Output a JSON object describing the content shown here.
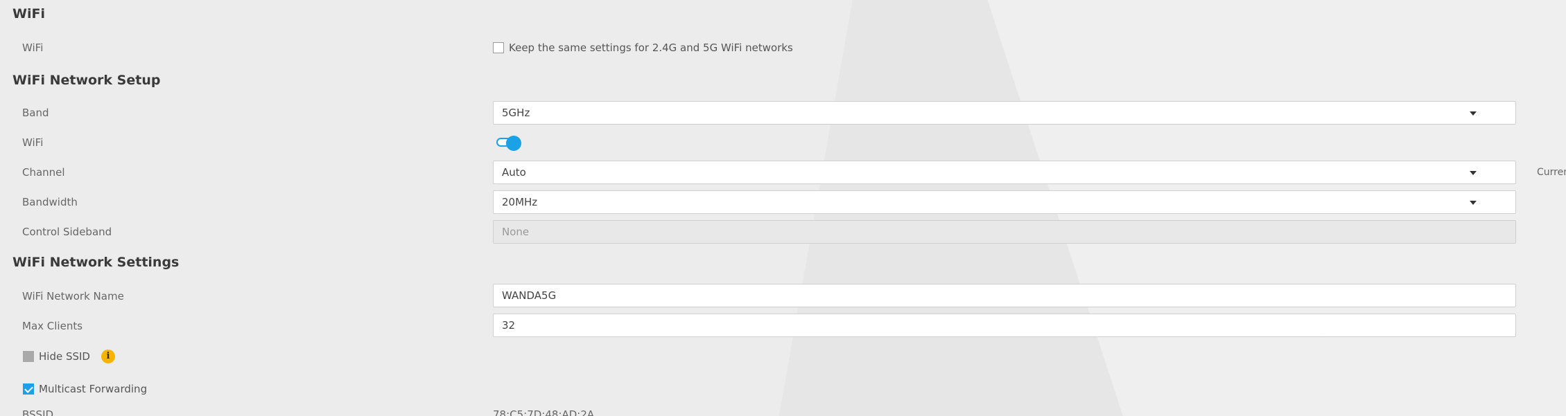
{
  "sections": {
    "wifi_title": "WiFi",
    "setup_title": "WiFi Network Setup",
    "settings_title": "WiFi Network Settings"
  },
  "wifi": {
    "label": "WiFi",
    "same_settings_label": "Keep the same settings for 2.4G and 5G WiFi networks",
    "same_settings_checked": false
  },
  "setup": {
    "band_label": "Band",
    "band_value": "5GHz",
    "wifi_label": "WiFi",
    "wifi_enabled": true,
    "channel_label": "Channel",
    "channel_value": "Auto",
    "channel_side_text": "Curren",
    "bandwidth_label": "Bandwidth",
    "bandwidth_value": "20MHz",
    "sideband_label": "Control Sideband",
    "sideband_value": "None"
  },
  "settings": {
    "network_name_label": "WiFi Network Name",
    "network_name_value": "WANDA5G",
    "max_clients_label": "Max Clients",
    "max_clients_value": "32",
    "hide_ssid_label": "Hide SSID",
    "hide_ssid_checked": false,
    "info_icon_glyph": "i",
    "multicast_label": "Multicast Forwarding",
    "multicast_checked": true,
    "bssid_label": "BSSID",
    "bssid_value": "78:C5:7D:48:AD:2A"
  },
  "colors": {
    "accent": "#1aa1e6",
    "info": "#f4b400",
    "background": "#ececec"
  },
  "icons": {
    "dropdown": "chevron-down-icon",
    "info": "info-icon",
    "checkbox": "checkbox-icon"
  }
}
